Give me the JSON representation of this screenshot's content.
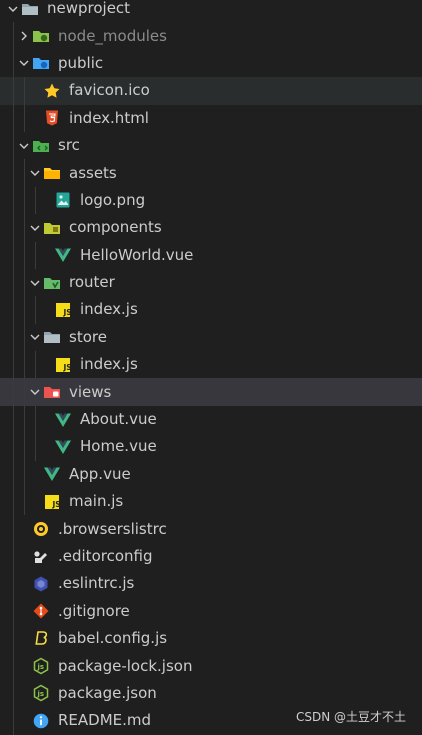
{
  "explorer": {
    "items": [
      {
        "label": "newproject",
        "type": "folder",
        "open": true,
        "depth": 0,
        "icon": "folder-open-icon",
        "name": "tree-folder-newproject"
      },
      {
        "label": "node_modules",
        "type": "folder",
        "open": false,
        "depth": 1,
        "icon": "node-folder-icon",
        "name": "tree-folder-node-modules",
        "dim": true
      },
      {
        "label": "public",
        "type": "folder",
        "open": true,
        "depth": 1,
        "icon": "public-folder-icon",
        "name": "tree-folder-public"
      },
      {
        "label": "favicon.ico",
        "type": "file",
        "depth": 2,
        "icon": "star-icon",
        "name": "tree-file-favicon",
        "hl": true
      },
      {
        "label": "index.html",
        "type": "file",
        "depth": 2,
        "icon": "html5-icon",
        "name": "tree-file-index-html"
      },
      {
        "label": "src",
        "type": "folder",
        "open": true,
        "depth": 1,
        "icon": "src-folder-icon",
        "name": "tree-folder-src"
      },
      {
        "label": "assets",
        "type": "folder",
        "open": true,
        "depth": 2,
        "icon": "assets-folder-icon",
        "name": "tree-folder-assets"
      },
      {
        "label": "logo.png",
        "type": "file",
        "depth": 3,
        "icon": "image-icon",
        "name": "tree-file-logo-png"
      },
      {
        "label": "components",
        "type": "folder",
        "open": true,
        "depth": 2,
        "icon": "components-folder-icon",
        "name": "tree-folder-components"
      },
      {
        "label": "HelloWorld.vue",
        "type": "file",
        "depth": 3,
        "icon": "vue-icon",
        "name": "tree-file-helloworld-vue"
      },
      {
        "label": "router",
        "type": "folder",
        "open": true,
        "depth": 2,
        "icon": "router-folder-icon",
        "name": "tree-folder-router"
      },
      {
        "label": "index.js",
        "type": "file",
        "depth": 3,
        "icon": "js-icon",
        "name": "tree-file-router-index-js"
      },
      {
        "label": "store",
        "type": "folder",
        "open": true,
        "depth": 2,
        "icon": "folder-open-icon",
        "name": "tree-folder-store"
      },
      {
        "label": "index.js",
        "type": "file",
        "depth": 3,
        "icon": "js-icon",
        "name": "tree-file-store-index-js"
      },
      {
        "label": "views",
        "type": "folder",
        "open": true,
        "depth": 2,
        "icon": "views-folder-icon",
        "name": "tree-folder-views",
        "selected": true
      },
      {
        "label": "About.vue",
        "type": "file",
        "depth": 3,
        "icon": "vue-icon",
        "name": "tree-file-about-vue"
      },
      {
        "label": "Home.vue",
        "type": "file",
        "depth": 3,
        "icon": "vue-icon",
        "name": "tree-file-home-vue"
      },
      {
        "label": "App.vue",
        "type": "file",
        "depth": 2,
        "icon": "vue-icon",
        "name": "tree-file-app-vue"
      },
      {
        "label": "main.js",
        "type": "file",
        "depth": 2,
        "icon": "js-icon",
        "name": "tree-file-main-js"
      },
      {
        "label": ".browserslistrc",
        "type": "file",
        "depth": 1,
        "icon": "browserslist-icon",
        "name": "tree-file-browserslistrc"
      },
      {
        "label": ".editorconfig",
        "type": "file",
        "depth": 1,
        "icon": "editorconfig-icon",
        "name": "tree-file-editorconfig"
      },
      {
        "label": ".eslintrc.js",
        "type": "file",
        "depth": 1,
        "icon": "eslint-icon",
        "name": "tree-file-eslintrc"
      },
      {
        "label": ".gitignore",
        "type": "file",
        "depth": 1,
        "icon": "git-icon",
        "name": "tree-file-gitignore"
      },
      {
        "label": "babel.config.js",
        "type": "file",
        "depth": 1,
        "icon": "babel-icon",
        "name": "tree-file-babel-config"
      },
      {
        "label": "package-lock.json",
        "type": "file",
        "depth": 1,
        "icon": "nodejs-icon",
        "name": "tree-file-package-lock"
      },
      {
        "label": "package.json",
        "type": "file",
        "depth": 1,
        "icon": "nodejs-icon",
        "name": "tree-file-package-json"
      },
      {
        "label": "README.md",
        "type": "file",
        "depth": 1,
        "icon": "info-icon",
        "name": "tree-file-readme"
      }
    ]
  },
  "watermark": "CSDN @土豆才不土",
  "colors": {
    "background": "#1f1f1f",
    "text": "#cccccc",
    "vue": "#41b883",
    "js": "#f5de19",
    "html": "#e44d26",
    "folder": "#90a4ae"
  }
}
